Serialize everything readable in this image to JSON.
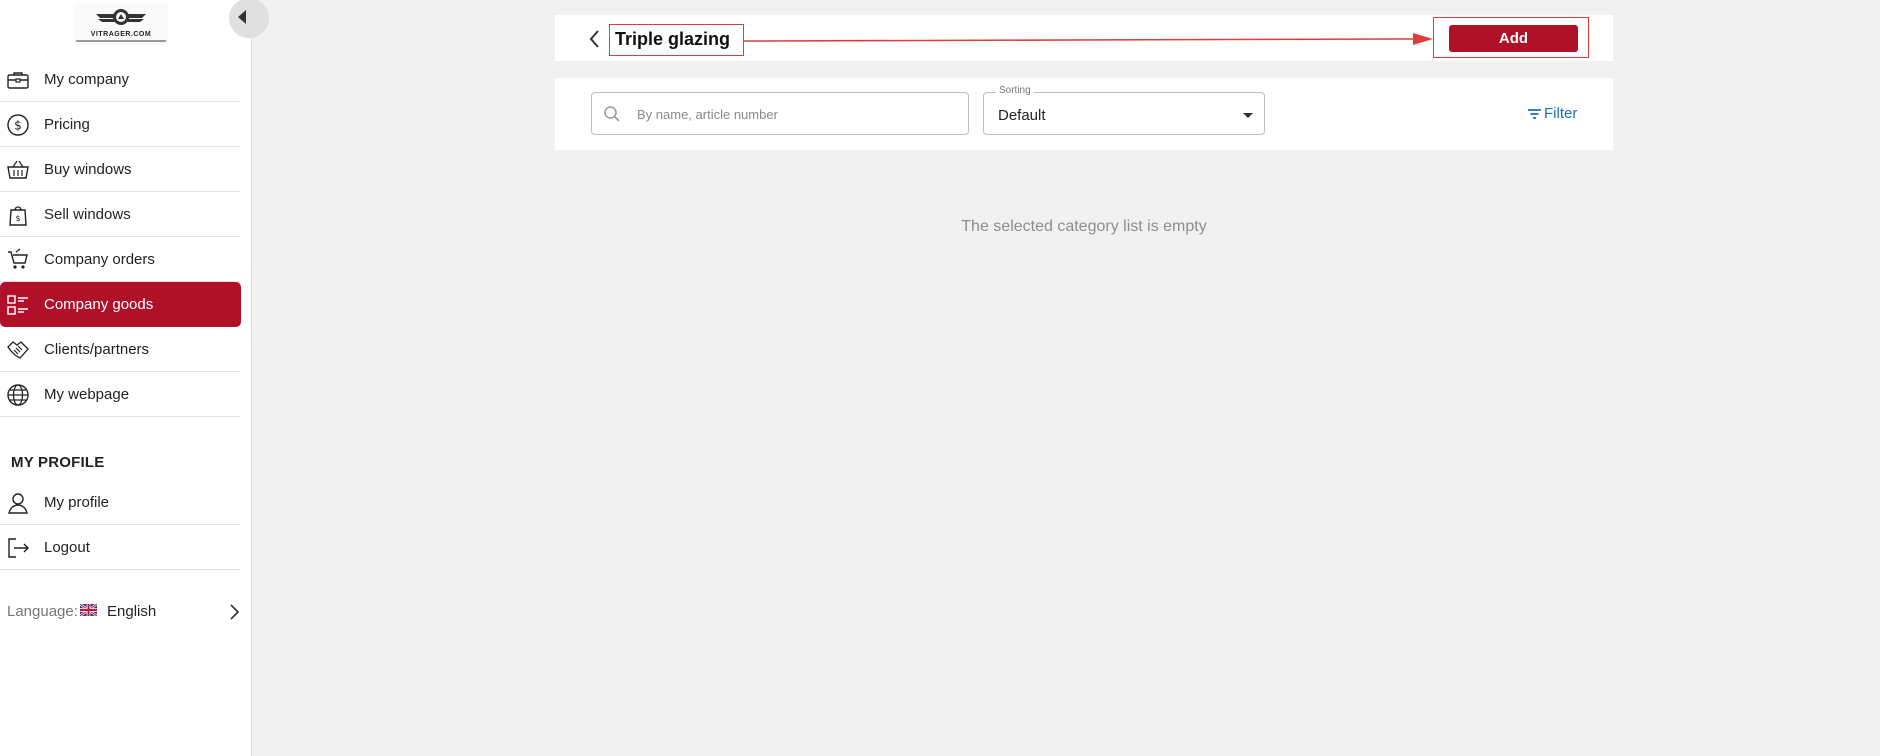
{
  "logo": {
    "text": "VITRAGER.COM"
  },
  "sidebar": {
    "items": [
      {
        "label": "My company",
        "icon": "briefcase-icon"
      },
      {
        "label": "Pricing",
        "icon": "dollar-circle-icon"
      },
      {
        "label": "Buy windows",
        "icon": "basket-icon"
      },
      {
        "label": "Sell windows",
        "icon": "shopping-bag-icon"
      },
      {
        "label": "Company orders",
        "icon": "cart-icon"
      },
      {
        "label": "Company goods",
        "icon": "list-grid-icon",
        "active": true
      },
      {
        "label": "Clients/partners",
        "icon": "handshake-icon"
      },
      {
        "label": "My webpage",
        "icon": "globe-icon"
      }
    ],
    "profile_title": "MY PROFILE",
    "profile_items": [
      {
        "label": "My profile",
        "icon": "user-icon"
      },
      {
        "label": "Logout",
        "icon": "logout-icon"
      }
    ],
    "language_label": "Language:",
    "language_value": "English"
  },
  "header": {
    "title": "Triple glazing",
    "add_label": "Add"
  },
  "toolbar": {
    "search_placeholder": "By name, article number",
    "sort_label": "Sorting",
    "sort_value": "Default",
    "filter_label": "Filter"
  },
  "main": {
    "empty_message": "The selected category list is empty"
  },
  "colors": {
    "accent": "#b01129",
    "link": "#1e6fb8",
    "annotation": "#e03c3c"
  }
}
